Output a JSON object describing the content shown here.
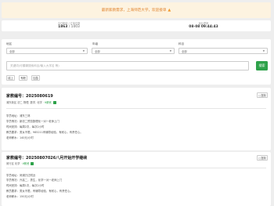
{
  "banner": {
    "text": "最新家教需求，上海师范大学，欢迎接单",
    "icon": "fire-icon"
  },
  "stats": {
    "left_label": "今日新增 / 订单总数",
    "left_today": "1863",
    "left_total": "1003",
    "right_label": "最后更新",
    "right_value": "08-08 09:44:43"
  },
  "filters": {
    "district_label": "地区",
    "grade_label": "年级",
    "subject_label": "科目",
    "district_value": "全部",
    "grade_value": "全部",
    "subject_value": "全部"
  },
  "search": {
    "placeholder": "关键词(可模糊搜索科目/输入大学名 等)",
    "button": "搜索"
  },
  "tags": [
    "线上",
    "专职",
    "加急"
  ],
  "cards": [
    {
      "title": "家教编号：2025080619",
      "copy": "复制",
      "meta": "浦东新区 初二 物理, 数学, 化学 · ",
      "fee": "¥薪资",
      "lines": [
        "学员地址：浦东三林",
        "学员情况：新初二预览数理化一对一老师上门",
        "时间安排：每周2次，每次2小时",
        "教员要求：男女不限，985211有辅导经验，有耐心，有责任心。",
        "老师薪水：140元/小时"
      ]
    },
    {
      "title": "家教编号：20250807026八月开始开学继续",
      "copy": "复制",
      "meta": "闵行区 化学 · ",
      "fee": "¥薪资",
      "lines": [
        "学员地址：闵浦万达附近",
        "学员情况：升高二，男生，化学一对一老师上门",
        "时间安排：每周1次，每次2小时",
        "教员要求：男女不限，有辅导经验，有耐心，有责任心。",
        "老师薪水：150元/小时"
      ]
    }
  ]
}
